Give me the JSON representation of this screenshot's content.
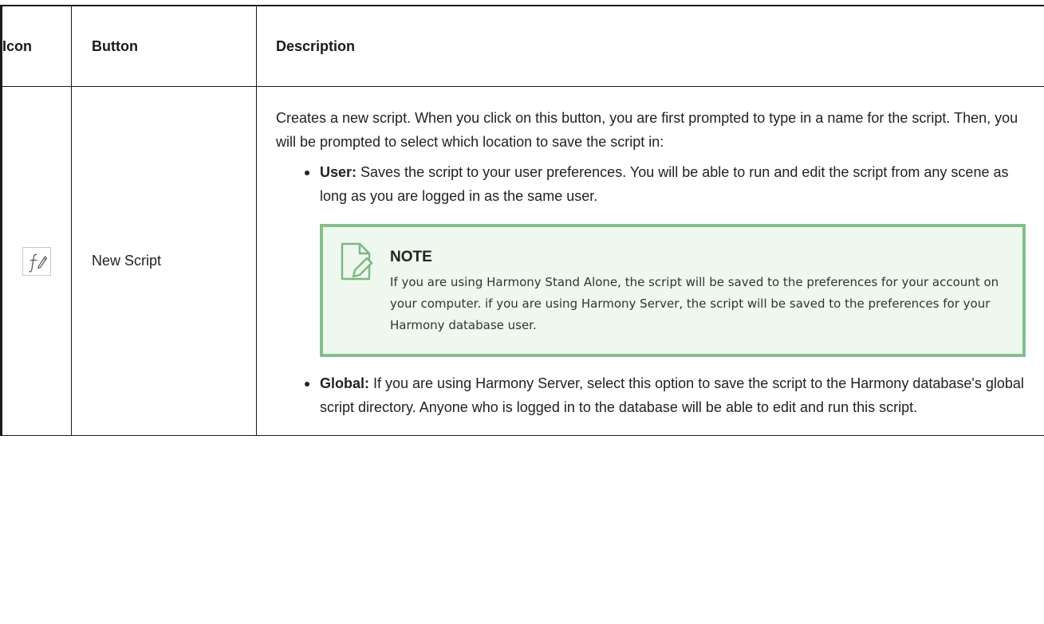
{
  "table": {
    "headers": {
      "icon": "Icon",
      "button": "Button",
      "description": "Description"
    },
    "rows": [
      {
        "icon_name": "new-script-icon",
        "button_label": "New Script",
        "description_intro": "Creates a new script. When you click on this button, you are first prompted to type in a name for the script. Then, you will be prompted to select which location to save the script in:",
        "bullets": [
          {
            "term": "User:",
            "text": " Saves the script to your user preferences. You will be able to run and edit the script from any scene as long as you are logged in as the same user."
          },
          {
            "term": "Global:",
            "text": " If you are using Harmony Server, select this option to save the script to the Harmony database's global script directory. Anyone who is logged in to the database will be able to edit and run this script."
          }
        ],
        "note": {
          "icon_name": "note-icon",
          "title": "NOTE",
          "text": "If you are using Harmony Stand Alone, the script will be saved to the preferences for your account on your computer. if you are using Harmony Server, the script will be saved to the preferences for your Harmony database user."
        }
      }
    ]
  },
  "colors": {
    "note_border": "#82c088",
    "note_background": "#eef8ee",
    "text": "#222222"
  }
}
